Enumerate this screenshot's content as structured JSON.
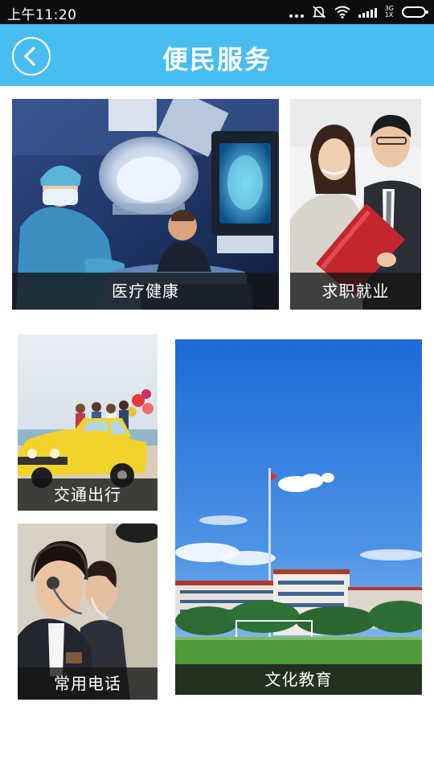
{
  "status_bar": {
    "time": "上午11:20",
    "network_top": "3G",
    "network_bottom": "1X",
    "icons": [
      "more-dots-icon",
      "mute-icon",
      "wifi-icon",
      "signal-icon",
      "battery-icon"
    ]
  },
  "header": {
    "title": "便民服务",
    "back_icon": "chevron-left-icon",
    "background": "#48bdf1"
  },
  "tiles": [
    {
      "label": "医疗健康"
    },
    {
      "label": "求职就业"
    },
    {
      "label": "交通出行"
    },
    {
      "label": "常用电话"
    },
    {
      "label": "文化教育"
    }
  ]
}
